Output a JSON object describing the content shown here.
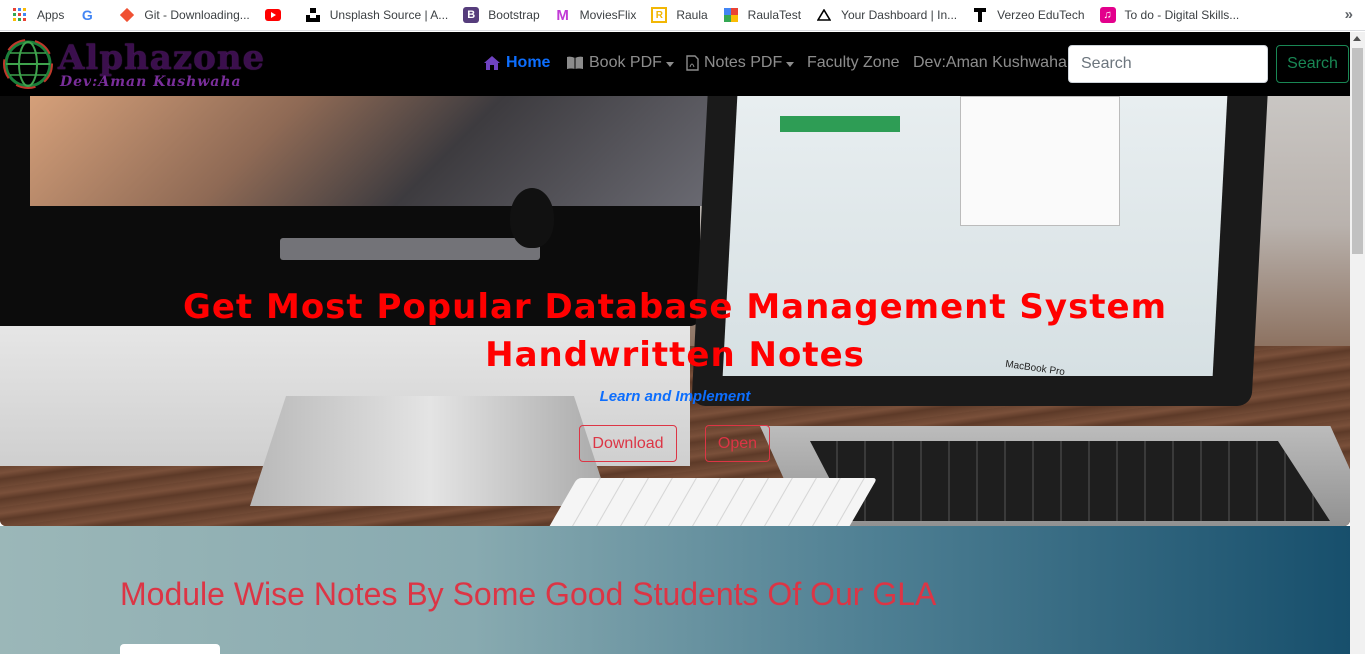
{
  "bookmarks": {
    "items": [
      {
        "label": "Apps",
        "icon": "apps-grid-icon"
      },
      {
        "label": "",
        "icon": "google-icon"
      },
      {
        "label": "Git - Downloading...",
        "icon": "git-icon"
      },
      {
        "label": "",
        "icon": "youtube-icon"
      },
      {
        "label": "Unsplash Source | A...",
        "icon": "unsplash-icon"
      },
      {
        "label": "Bootstrap",
        "icon": "bootstrap-icon"
      },
      {
        "label": "MoviesFlix",
        "icon": "moviesflix-icon"
      },
      {
        "label": "Raula",
        "icon": "raula-icon"
      },
      {
        "label": "RaulaTest",
        "icon": "raulatest-icon"
      },
      {
        "label": "Your Dashboard | In...",
        "icon": "dashboard-icon"
      },
      {
        "label": "Verzeo EduTech",
        "icon": "verzeo-icon"
      },
      {
        "label": "To do - Digital Skills...",
        "icon": "todo-icon"
      }
    ],
    "more": "»"
  },
  "navbar": {
    "brand_name": "Alphazone",
    "brand_dev": "Dev:Aman Kushwaha",
    "items": {
      "home": "Home",
      "book_pdf": "Book PDF",
      "notes_pdf": "Notes PDF",
      "faculty_zone": "Faculty Zone",
      "dev": "Dev:Aman Kushwaha"
    },
    "search_placeholder": "Search",
    "search_button": "Search"
  },
  "hero": {
    "title_line1": "Get Most Popular Database Management System",
    "title_line2": "Handwritten Notes",
    "subtitle": "Learn and Implement",
    "download_button": "Download",
    "open_button": "Open",
    "laptop_brand": "MacBook Pro"
  },
  "section": {
    "title": "Module Wise Notes By Some Good Students Of Our GLA"
  },
  "colors": {
    "navbar_bg": "#000000",
    "home_active": "#0d6efd",
    "hero_title": "#ff0000",
    "hero_subtitle": "#0d6efd",
    "outline_danger": "#dc3545",
    "search_button": "#198754"
  }
}
